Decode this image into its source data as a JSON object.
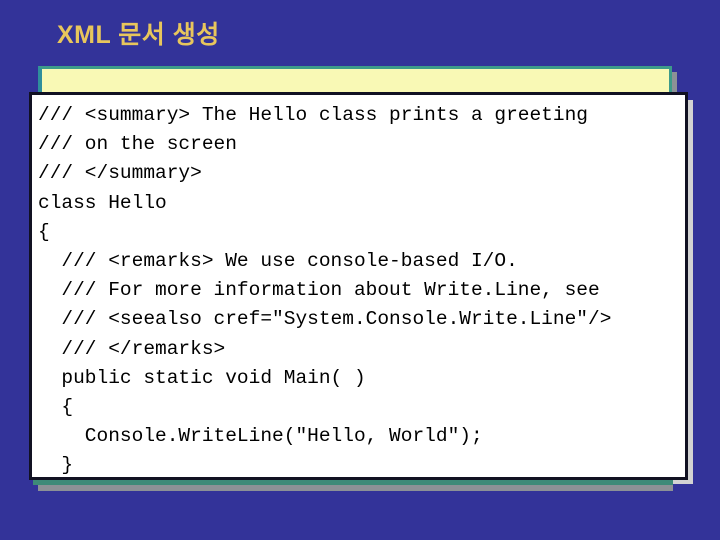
{
  "slide": {
    "title": "XML 문서 생성",
    "background_color": "#333399",
    "title_color": "#e8c65c"
  },
  "banner": {
    "text": "",
    "fill_color": "#f9f9b5",
    "border_color": "#3d9b8a",
    "shadow_color": "#8c9196"
  },
  "code_block": {
    "language": "csharp",
    "background_color": "#ffffff",
    "border_color": "#111122",
    "text_color": "#000000",
    "lines": [
      "/// <summary> The Hello class prints a greeting",
      "/// on the screen",
      "/// </summary>",
      "class Hello",
      "{",
      "  /// <remarks> We use console-based I/O.",
      "  /// For more information about Write.Line, see",
      "  /// <seealso cref=\"System.Console.Write.Line\"/>",
      "  /// </remarks>",
      "  public static void Main( )",
      "  {",
      "    Console.WriteLine(\"Hello, World\");",
      "  }",
      "}"
    ],
    "text": "/// <summary> The Hello class prints a greeting\n/// on the screen\n/// </summary>\nclass Hello\n{\n  /// <remarks> We use console-based I/O.\n  /// For more information about Write.Line, see\n  /// <seealso cref=\"System.Console.Write.Line\"/>\n  /// </remarks>\n  public static void Main( )\n  {\n    Console.WriteLine(\"Hello, World\");\n  }\n}"
  }
}
